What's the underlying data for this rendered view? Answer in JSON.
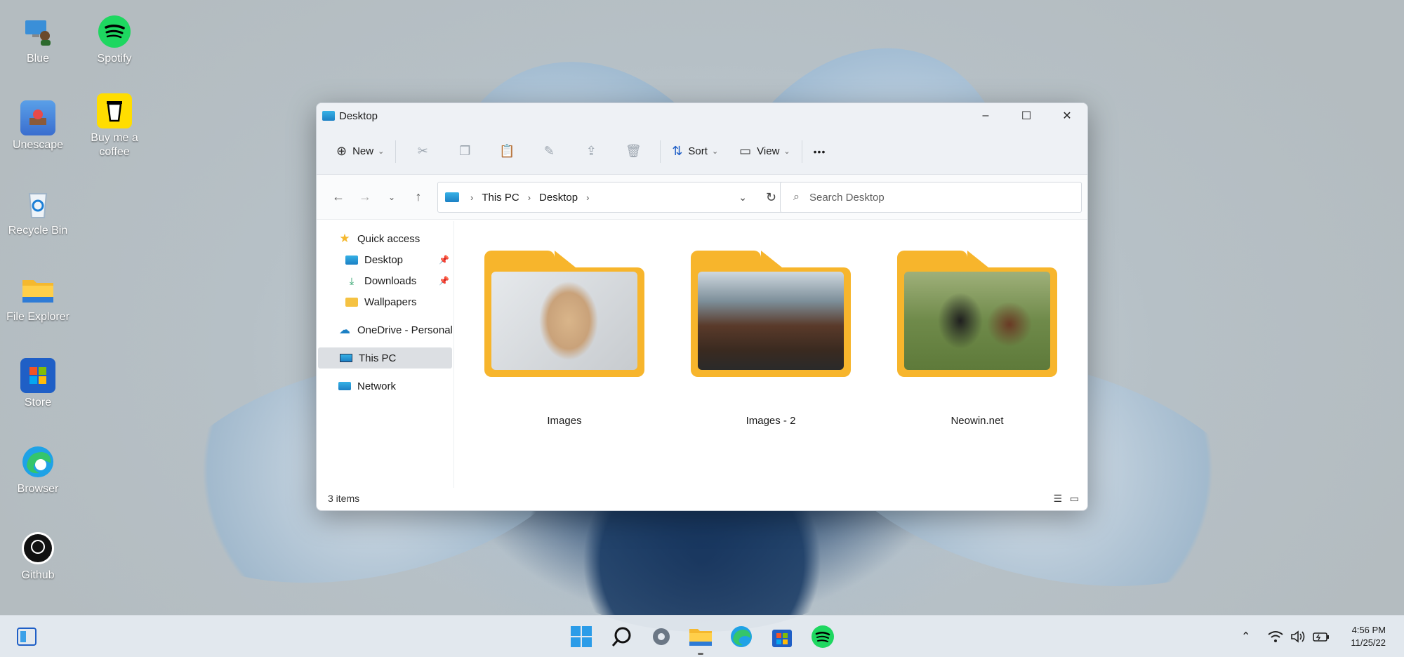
{
  "desktop": {
    "icons": [
      {
        "label": "Blue"
      },
      {
        "label": "Spotify"
      },
      {
        "label": "Unescape"
      },
      {
        "label": "Buy me a coffee"
      },
      {
        "label": "Recycle Bin"
      },
      {
        "label": "File Explorer"
      },
      {
        "label": "Store"
      },
      {
        "label": "Browser"
      },
      {
        "label": "Github"
      }
    ]
  },
  "window": {
    "title": "Desktop",
    "controls": {
      "minimize": "–",
      "maximize": "☐",
      "close": "✕"
    },
    "toolbar": {
      "new_label": "New",
      "sort_label": "Sort",
      "view_label": "View",
      "more_label": "•••"
    },
    "address": {
      "segments": [
        "This PC",
        "Desktop"
      ]
    },
    "search": {
      "placeholder": "Search Desktop"
    },
    "sidebar": {
      "items": [
        {
          "label": "Quick access"
        },
        {
          "label": "Desktop"
        },
        {
          "label": "Downloads"
        },
        {
          "label": "Wallpapers"
        },
        {
          "label": "OneDrive - Personal"
        },
        {
          "label": "This PC"
        },
        {
          "label": "Network"
        }
      ]
    },
    "folders": [
      {
        "name": "Images"
      },
      {
        "name": "Images - 2"
      },
      {
        "name": "Neowin.net"
      }
    ],
    "status": {
      "item_count": "3 items"
    }
  },
  "taskbar": {
    "clock": {
      "time": "4:56 PM",
      "date": "11/25/22"
    }
  }
}
